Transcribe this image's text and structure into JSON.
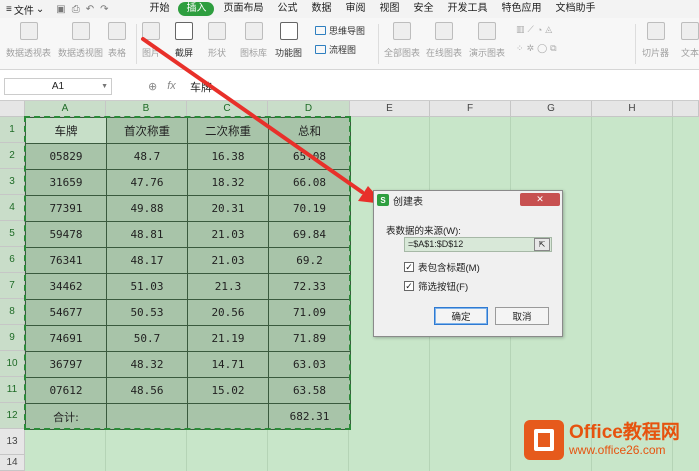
{
  "menu": {
    "file_label": "文件",
    "tabs": [
      {
        "label": "开始",
        "active": false
      },
      {
        "label": "插入",
        "active": true
      },
      {
        "label": "页面布局",
        "active": false
      },
      {
        "label": "公式",
        "active": false
      },
      {
        "label": "数据",
        "active": false
      },
      {
        "label": "审阅",
        "active": false
      },
      {
        "label": "视图",
        "active": false
      },
      {
        "label": "安全",
        "active": false
      },
      {
        "label": "开发工具",
        "active": false
      },
      {
        "label": "特色应用",
        "active": false
      },
      {
        "label": "文档助手",
        "active": false
      }
    ],
    "accent_color": "#2e9e3f"
  },
  "ribbon": {
    "buttons": [
      {
        "label": "数据透视表",
        "enabled": false,
        "icon": "pivot-table-icon"
      },
      {
        "label": "数据透视图",
        "enabled": false,
        "icon": "pivot-chart-icon"
      },
      {
        "label": "表格",
        "enabled": false,
        "icon": "table-icon"
      },
      {
        "label": "图片",
        "enabled": false,
        "icon": "picture-icon"
      },
      {
        "label": "截屏",
        "enabled": true,
        "icon": "screenshot-icon"
      },
      {
        "label": "形状",
        "enabled": false,
        "icon": "shape-icon"
      },
      {
        "label": "图标库",
        "enabled": false,
        "icon": "icon-library-icon"
      },
      {
        "label": "功能图",
        "enabled": true,
        "icon": "function-chart-icon"
      },
      {
        "label": "全部图表",
        "enabled": false,
        "icon": "all-charts-icon"
      },
      {
        "label": "在线图表",
        "enabled": false,
        "icon": "online-chart-icon"
      },
      {
        "label": "演示图表",
        "enabled": false,
        "icon": "demo-chart-icon"
      },
      {
        "label": "切片器",
        "enabled": false,
        "icon": "slicer-icon"
      },
      {
        "label": "文本",
        "enabled": false,
        "icon": "text-icon"
      }
    ],
    "small_buttons": [
      {
        "label": "思维导图",
        "icon": "mind-map-icon"
      },
      {
        "label": "流程图",
        "icon": "flowchart-icon"
      }
    ]
  },
  "formula_bar": {
    "cell_ref": "A1",
    "value": "车牌"
  },
  "sheet": {
    "columns": [
      "A",
      "B",
      "C",
      "D",
      "E",
      "F",
      "G",
      "H"
    ],
    "rows": [
      "1",
      "2",
      "3",
      "4",
      "5",
      "6",
      "7",
      "8",
      "9",
      "10",
      "11",
      "12",
      "13",
      "14"
    ],
    "headers": [
      "车牌",
      "首次称重",
      "二次称重",
      "总和"
    ],
    "data": [
      [
        "05829",
        "48.7",
        "16.38",
        "65.08"
      ],
      [
        "31659",
        "47.76",
        "18.32",
        "66.08"
      ],
      [
        "77391",
        "49.88",
        "20.31",
        "70.19"
      ],
      [
        "59478",
        "48.81",
        "21.03",
        "69.84"
      ],
      [
        "76341",
        "48.17",
        "21.03",
        "69.2"
      ],
      [
        "34462",
        "51.03",
        "21.3",
        "72.33"
      ],
      [
        "54677",
        "50.53",
        "20.56",
        "71.09"
      ],
      [
        "74691",
        "50.7",
        "21.19",
        "71.89"
      ],
      [
        "36797",
        "48.32",
        "14.71",
        "63.03"
      ],
      [
        "07612",
        "48.56",
        "15.02",
        "63.58"
      ]
    ],
    "total": [
      "合计:",
      "",
      "",
      "682.31"
    ]
  },
  "dialog": {
    "title": "创建表",
    "logo": "S",
    "close": "✕",
    "source_label": "表数据的来源(W):",
    "source_value": "=$A$1:$D$12",
    "checkbox_header": {
      "label": "表包含标题(M)",
      "checked": true
    },
    "checkbox_filter": {
      "label": "筛选按钮(F)",
      "checked": true
    },
    "ok": "确定",
    "cancel": "取消"
  },
  "watermark": {
    "main": "Office教程网",
    "sub": "www.office26.com"
  }
}
